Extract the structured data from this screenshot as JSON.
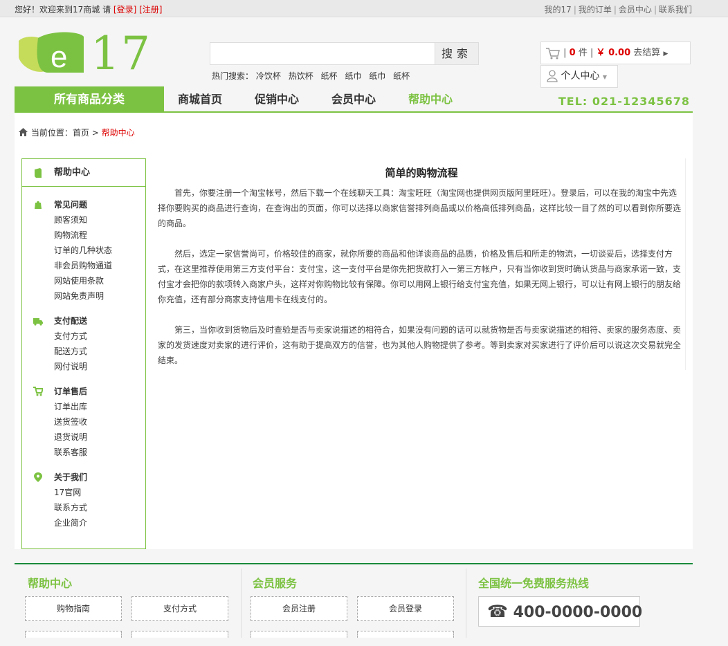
{
  "topbar": {
    "greeting": "您好！欢迎来到17商城 请",
    "login": "[登录]",
    "register": "[注册]",
    "links": [
      "我的17",
      "我的订单",
      "会员中心",
      "联系我们"
    ]
  },
  "header": {
    "logo_letter": "e",
    "logo_number": "17",
    "search_button": "搜索",
    "search_placeholder": "",
    "hot_label": "热门搜索：",
    "hot_terms": [
      "冷饮杯",
      "热饮杯",
      "纸杯",
      "纸巾",
      "纸巾",
      "纸杯"
    ],
    "cart_count": "0",
    "cart_unit": "件",
    "cart_total": "￥ 0.00",
    "checkout": "去结算",
    "user_center": "个人中心"
  },
  "nav": {
    "all_categories": "所有商品分类",
    "items": [
      "商城首页",
      "促销中心",
      "会员中心",
      "帮助中心"
    ],
    "active_index": 3,
    "tel": "TEL: 021-12345678"
  },
  "breadcrumb": {
    "label": "当前位置：",
    "home": "首页",
    "sep": ">",
    "current": "帮助中心"
  },
  "sidebar": {
    "title": "帮助中心",
    "groups": [
      {
        "title": "常见问题",
        "icon": "bag-icon",
        "items": [
          "顾客须知",
          "购物流程",
          "订单的几种状态",
          "非会员购物通道",
          "网站使用条款",
          "网站免责声明"
        ]
      },
      {
        "title": "支付配送",
        "icon": "truck-icon",
        "items": [
          "支付方式",
          "配送方式",
          "网付说明"
        ]
      },
      {
        "title": "订单售后",
        "icon": "cart-icon",
        "items": [
          "订单出库",
          "送货签收",
          "退货说明",
          "联系客服"
        ]
      },
      {
        "title": "关于我们",
        "icon": "location-icon",
        "items": [
          "17官网",
          "联系方式",
          "企业简介"
        ]
      }
    ]
  },
  "article": {
    "title": "简单的购物流程",
    "paragraphs": [
      "首先，你要注册一个淘宝帐号，然后下载一个在线聊天工具：淘宝旺旺（淘宝网也提供网页版阿里旺旺）。登录后，可以在我的淘宝中先选择你要购买的商品进行查询，在查询出的页面，你可以选择以商家信誉排列商品或以价格高低排列商品，这样比较一目了然的可以看到你所要选的商品。",
      "然后，选定一家信誉尚可，价格较佳的商家，就你所要的商品和他详谈商品的品质，价格及售后和所走的物流，一切谈妥后，选择支付方式，在这里推荐使用第三方支付平台：支付宝，这一支付平台是你先把货款打入一第三方帐户，只有当你收到货时确认货品与商家承诺一致，支付宝才会把你的款项转入商家户头，这样对你购物比较有保障。你可以用网上银行给支付宝充值，如果无网上银行，可以让有网上银行的朋友给你充值，还有部分商家支持信用卡在线支付的。",
      "第三，当你收到货物后及时查验是否与卖家说描述的相符合，如果没有问题的话可以就货物是否与卖家说描述的相符、卖家的服务态度、卖家的发货速度对卖家的进行评价，这有助于提高双方的信誉，也为其他人购物提供了参考。等到卖家对买家进行了评价后可以说这次交易就完全结束。"
    ]
  },
  "footer": {
    "help_title": "帮助中心",
    "help_buttons": [
      "购物指南",
      "支付方式"
    ],
    "member_title": "会员服务",
    "member_buttons": [
      "会员注册",
      "会员登录"
    ],
    "hotline_title": "全国统一免费服务热线",
    "hotline": "400-0000-0000"
  },
  "colors": {
    "brand_green": "#7cc242",
    "footer_line": "#1a8a3a",
    "price_red": "#dd0000"
  }
}
